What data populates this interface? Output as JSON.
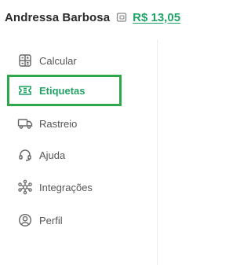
{
  "header": {
    "user_name": "Andressa Barbosa",
    "balance": "R$ 13,05"
  },
  "sidebar": {
    "items": [
      {
        "label": "Calcular",
        "icon": "calculator-icon",
        "active": false
      },
      {
        "label": "Etiquetas",
        "icon": "ticket-icon",
        "active": true
      },
      {
        "label": "Rastreio",
        "icon": "truck-icon",
        "active": false
      },
      {
        "label": "Ajuda",
        "icon": "headset-icon",
        "active": false
      },
      {
        "label": "Integrações",
        "icon": "network-icon",
        "active": false
      },
      {
        "label": "Perfil",
        "icon": "user-circle-icon",
        "active": false
      }
    ]
  },
  "colors": {
    "accent": "#21a366",
    "active_border": "#2ea84a",
    "text": "#555555"
  }
}
